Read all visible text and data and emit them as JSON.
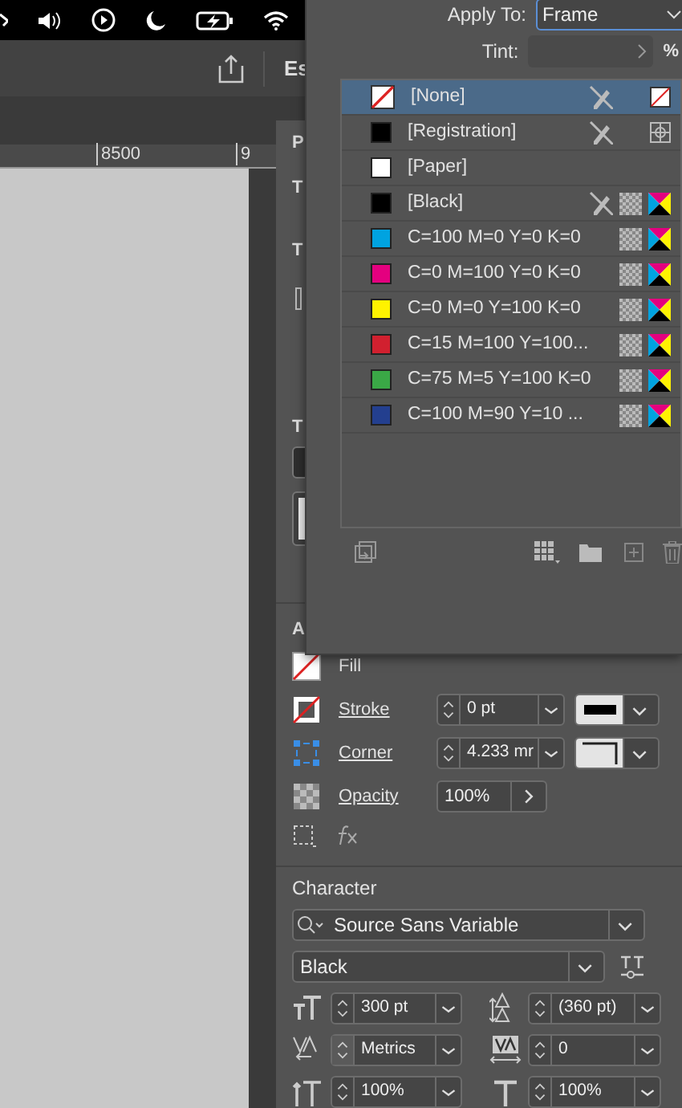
{
  "toolbar": {
    "workspace_label": "Es"
  },
  "ruler": {
    "labels": [
      "8500",
      "9"
    ]
  },
  "properties_panel": {
    "cut_labels": [
      "P",
      "T",
      "T",
      "T",
      "A"
    ],
    "appearance": {
      "rows": [
        {
          "kind": "fill",
          "label": "Fill"
        },
        {
          "kind": "stroke",
          "label": "Stroke",
          "value": "0 pt"
        },
        {
          "kind": "corner",
          "label": "Corner",
          "value": "4.233 mr"
        },
        {
          "kind": "opacity",
          "label": "Opacity",
          "value": "100%"
        }
      ]
    },
    "character": {
      "title": "Character",
      "font": "Source Sans Variable",
      "style": "Black",
      "fields": [
        {
          "kind": "size",
          "value": "300 pt"
        },
        {
          "kind": "leading",
          "value": "(360 pt)"
        },
        {
          "kind": "kerning",
          "value": "Metrics"
        },
        {
          "kind": "tracking",
          "value": "0"
        },
        {
          "kind": "vscale",
          "value": "100%"
        },
        {
          "kind": "hscale",
          "value": "100%"
        }
      ]
    }
  },
  "swatches_panel": {
    "apply_to_label": "Apply To:",
    "apply_to": "Frame",
    "tint_label": "Tint:",
    "tint_unit": "%",
    "swatches": [
      {
        "name": "[None]",
        "kind": "none",
        "locked": true,
        "selected": true
      },
      {
        "name": "[Registration]",
        "kind": "registration",
        "color": "#000000",
        "locked": true,
        "selected": false
      },
      {
        "name": "[Paper]",
        "kind": "paper",
        "color": "#ffffff",
        "locked": false,
        "selected": false
      },
      {
        "name": "[Black]",
        "kind": "process",
        "color": "#000000",
        "locked": true,
        "selected": false
      },
      {
        "name": "C=100 M=0 Y=0 K=0",
        "kind": "process",
        "color": "#00a3e0",
        "locked": false,
        "selected": false
      },
      {
        "name": "C=0 M=100 Y=0 K=0",
        "kind": "process",
        "color": "#e4007f",
        "locked": false,
        "selected": false
      },
      {
        "name": "C=0 M=0 Y=100 K=0",
        "kind": "process",
        "color": "#fff200",
        "locked": false,
        "selected": false
      },
      {
        "name": "C=15 M=100 Y=100...",
        "kind": "process",
        "color": "#d1202f",
        "locked": false,
        "selected": false
      },
      {
        "name": "C=75 M=5 Y=100 K=0",
        "kind": "process",
        "color": "#3aa846",
        "locked": false,
        "selected": false
      },
      {
        "name": "C=100 M=90 Y=10 ...",
        "kind": "process",
        "color": "#233f8f",
        "locked": false,
        "selected": false
      }
    ]
  }
}
